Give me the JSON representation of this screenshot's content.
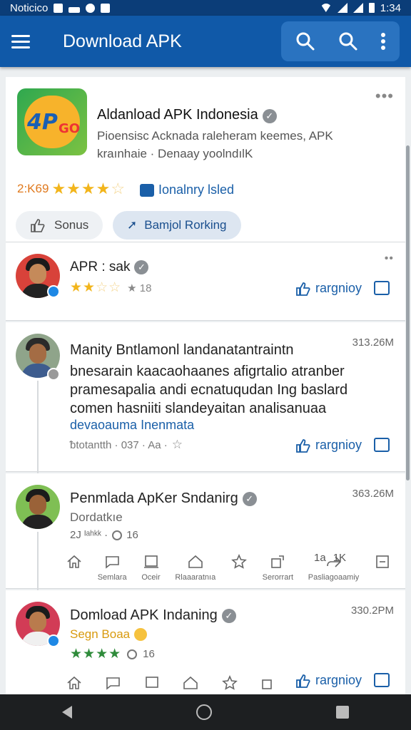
{
  "status_bar": {
    "carrier": "Noticico",
    "time": "1:34"
  },
  "app_bar": {
    "title": "Download APK",
    "menu_icon": "menu-icon",
    "search_icon": "search-icon",
    "search_icon_2": "search-icon",
    "more_icon": "more-vert-icon"
  },
  "app_card": {
    "title": "Aldanload APK Indonesia",
    "subtitle_line1": "Pioensisc Acknada raleheram keemes, APK",
    "subtitle_line2": "kraınhaie · Denaay yoolndılK",
    "rating_text": "2:K69",
    "rating_stars": 3.5,
    "badge_label": "Ionalnry lsled",
    "pill_left": "Sonus",
    "pill_right": "Bamjol Rorking",
    "accent": "#1a5fa8"
  },
  "posts": [
    {
      "author": "APR : sak",
      "rating_stars": 2.5,
      "rating_meta": "★ 18",
      "action_label": "rargnioy"
    },
    {
      "author": "Manity Bntlamonl landanatantraintn",
      "time": "313.26M",
      "body_line1": "bnesarain kaacaohaanes afigrtalio atranber",
      "body_line2": "pramesapalia andi ecnatuqudan Ing baslard",
      "body_line3": "comen hasniiti slandeyaitan analisanuaa",
      "link": "devaoauma Inenmata",
      "meta": "ᵬtotantth · 037 · Aa ·",
      "action_label": "rargnioy"
    },
    {
      "author": "Penmlada ApKer Sndanirg",
      "time": "363.26M",
      "subline": "Dordatkıe",
      "meta": "2J ᴵᵃʰᵏᵏ ·",
      "count": "16",
      "icons": [
        {
          "name": "home-icon",
          "label": ""
        },
        {
          "name": "chat-icon",
          "label": "Semlara"
        },
        {
          "name": "card-icon",
          "label": "Oceir"
        },
        {
          "name": "house-icon",
          "label": "Rlaaaratnıa"
        },
        {
          "name": "star-icon",
          "label": ""
        },
        {
          "name": "share-icon",
          "label": "Serorrart"
        },
        {
          "name": "forward-icon",
          "label": "Pasliagoaamiy"
        },
        {
          "name": "stats-icon",
          "label": ""
        }
      ],
      "forward_text": "1a",
      "forward_count": "1K"
    },
    {
      "author": "Domload APK Indaning",
      "time": "330.2PM",
      "subline": "Segn Boaa",
      "rating_stars": 4,
      "count": "16",
      "action_label": "rargnioy"
    }
  ]
}
